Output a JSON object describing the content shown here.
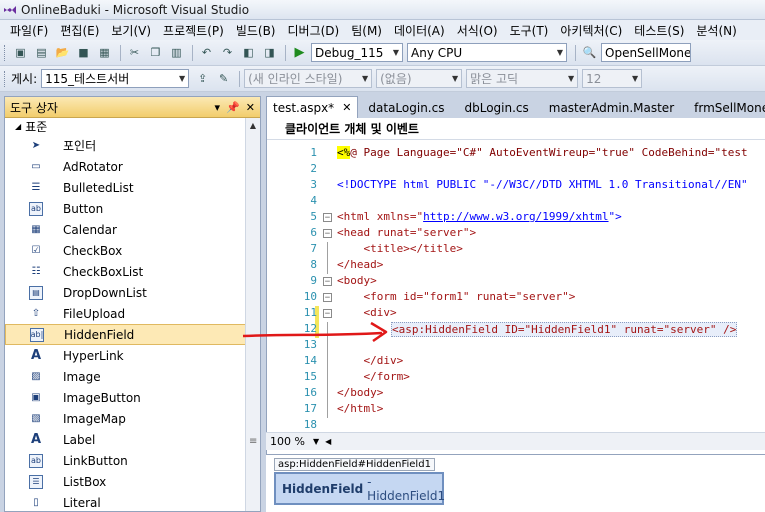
{
  "window": {
    "title": "OnlineBaduki - Microsoft Visual Studio"
  },
  "menu": [
    "파일(F)",
    "편집(E)",
    "보기(V)",
    "프로젝트(P)",
    "빌드(B)",
    "디버그(D)",
    "팀(M)",
    "데이터(A)",
    "서식(O)",
    "도구(T)",
    "아키텍처(C)",
    "테스트(S)",
    "분석(N)"
  ],
  "toolbar1": {
    "config": "Debug_115",
    "platform": "Any CPU",
    "find": "OpenSellMoney"
  },
  "toolbar2": {
    "label": "게시:",
    "publish": "115_테스트서버",
    "style": "(새 인라인 스타일)",
    "block": "(없음)",
    "font": "맑은 고딕",
    "size": "12"
  },
  "toolbox": {
    "title": "도구 상자",
    "section": "표준",
    "items": [
      {
        "label": "포인터",
        "icon": "pointer-icon"
      },
      {
        "label": "AdRotator",
        "icon": "adrotator-icon"
      },
      {
        "label": "BulletedList",
        "icon": "bulletedlist-icon"
      },
      {
        "label": "Button",
        "icon": "button-icon"
      },
      {
        "label": "Calendar",
        "icon": "calendar-icon"
      },
      {
        "label": "CheckBox",
        "icon": "checkbox-icon"
      },
      {
        "label": "CheckBoxList",
        "icon": "checkboxlist-icon"
      },
      {
        "label": "DropDownList",
        "icon": "dropdownlist-icon"
      },
      {
        "label": "FileUpload",
        "icon": "fileupload-icon"
      },
      {
        "label": "HiddenField",
        "icon": "hiddenfield-icon"
      },
      {
        "label": "HyperLink",
        "icon": "hyperlink-icon"
      },
      {
        "label": "Image",
        "icon": "image-icon"
      },
      {
        "label": "ImageButton",
        "icon": "imagebutton-icon"
      },
      {
        "label": "ImageMap",
        "icon": "imagemap-icon"
      },
      {
        "label": "Label",
        "icon": "label-icon"
      },
      {
        "label": "LinkButton",
        "icon": "linkbutton-icon"
      },
      {
        "label": "ListBox",
        "icon": "listbox-icon"
      },
      {
        "label": "Literal",
        "icon": "literal-icon"
      }
    ]
  },
  "tabs": [
    "test.aspx*",
    "dataLogin.cs",
    "dbLogin.cs",
    "masterAdmin.Master",
    "frmSellMoney_L"
  ],
  "editor": {
    "nav": "클라이언트 개체 및 이벤트",
    "zoom": "100 %",
    "lines": [
      "1",
      "2",
      "3",
      "4",
      "5",
      "6",
      "7",
      "8",
      "9",
      "10",
      "11",
      "12",
      "13",
      "14",
      "15",
      "16",
      "17",
      "18"
    ],
    "code": {
      "l1a": "<%",
      "l1b": "@ Page Language=\"C#\" AutoEventWireup=\"true\" CodeBehind=\"test",
      "l3": "<!DOCTYPE html PUBLIC \"-//W3C//DTD XHTML 1.0 Transitional//EN\"",
      "l5a": "<html xmlns=\"",
      "l5b": "http://www.w3.org/1999/xhtml",
      "l5c": "\">",
      "l6": "<head runat=\"server\">",
      "l7": "    <title></title>",
      "l8": "</head>",
      "l9": "<body>",
      "l10": "    <form id=\"form1\" runat=\"server\">",
      "l11": "    <div>",
      "l12": "<asp:HiddenField ID=\"HiddenField1\" runat=\"server\" />",
      "l14": "    </div>",
      "l15": "    </form>",
      "l16": "</body>",
      "l17": "</html>"
    }
  },
  "design": {
    "breadcrumb": "asp:HiddenField#HiddenField1",
    "control_type": "HiddenField",
    "control_id": "- HiddenField1"
  },
  "colors": {
    "annotation": "#e01818",
    "selection": "#fde9b5"
  }
}
